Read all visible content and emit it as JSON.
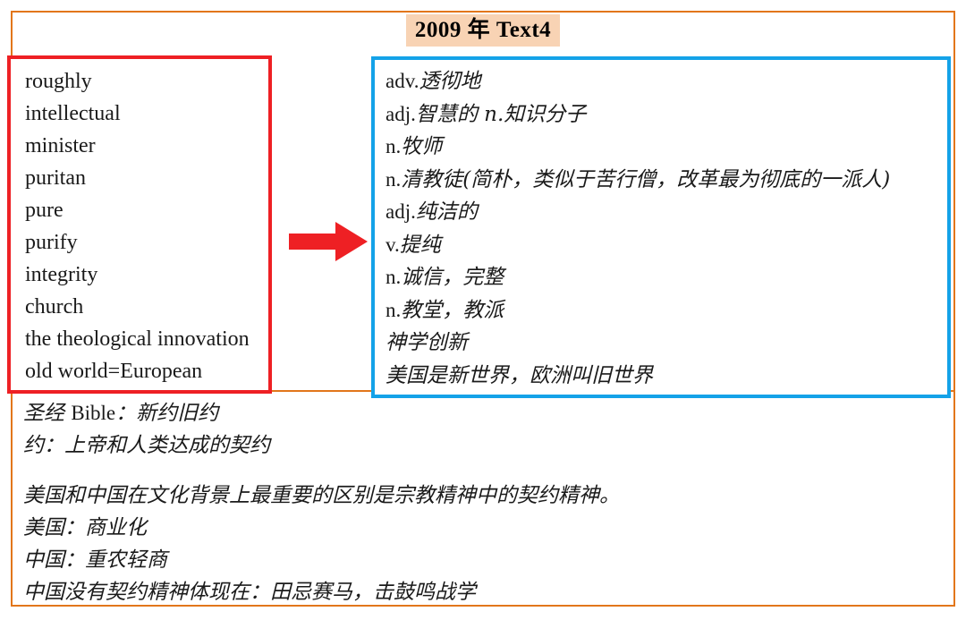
{
  "page": {
    "title": "2009 年 Text4",
    "frame_color": "#E2761B",
    "title_highlight_color": "#F8D3B4",
    "word_box_border_color": "#EE2024",
    "def_box_border_color": "#14A2E8",
    "arrow_color": "#EE2024"
  },
  "word_box": {
    "words": [
      "roughly",
      "intellectual",
      "minister",
      "puritan",
      "pure",
      "purify",
      "integrity",
      "church",
      "the theological innovation",
      "old world=European"
    ]
  },
  "def_box": {
    "definitions": [
      {
        "pos": "adv.",
        "meaning": "透彻地"
      },
      {
        "pos": "adj.",
        "meaning": "智慧的 n.知识分子"
      },
      {
        "pos": "n.",
        "meaning": "牧师"
      },
      {
        "pos": "n.",
        "meaning": "清教徒(简朴，类似于苦行僧，改革最为彻底的一派人)"
      },
      {
        "pos": "adj.",
        "meaning": "纯洁的"
      },
      {
        "pos": "v.",
        "meaning": "提纯"
      },
      {
        "pos": "n.",
        "meaning": "诚信，完整"
      },
      {
        "pos": "n.",
        "meaning": "教堂，教派"
      },
      {
        "pos": "",
        "meaning": "神学创新"
      },
      {
        "pos": "",
        "meaning": "美国是新世界，欧洲叫旧世界"
      }
    ]
  },
  "notes": {
    "bible_prefix": "圣经 ",
    "bible_latin": "Bible",
    "bible_suffix": "：新约旧约",
    "covenant": "约：上帝和人类达成的契约",
    "comparison": "美国和中国在文化背景上最重要的区别是宗教精神中的契约精神。",
    "usa": "美国：商业化",
    "china": "中国：重农轻商",
    "china_no_covenant": "中国没有契约精神体现在：田忌赛马，击鼓鸣战学"
  },
  "arrow": {
    "label": "arrow pointing right from word list to definitions"
  }
}
